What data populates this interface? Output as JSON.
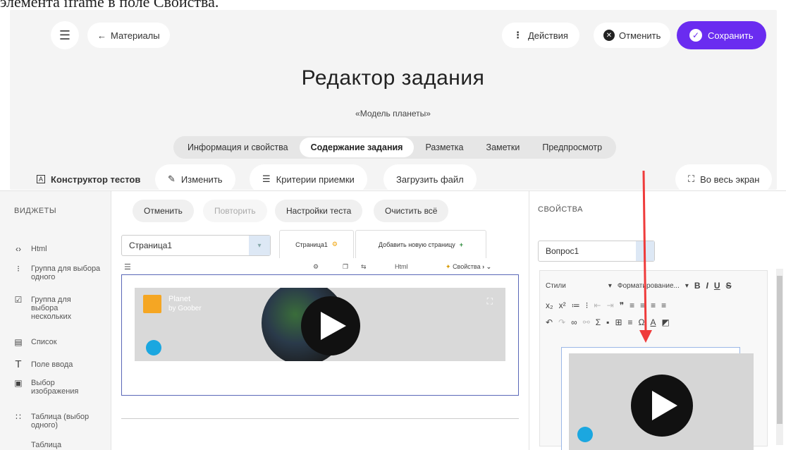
{
  "doc_strip": "элемента iframe в поле Свойства.",
  "header": {
    "back_label": "Материалы",
    "actions_label": "Действия",
    "cancel_label": "Отменить",
    "save_label": "Сохранить",
    "title": "Редактор задания",
    "subtitle": "«Модель планеты»",
    "tabs": [
      "Информация и свойства",
      "Содержание задания",
      "Разметка",
      "Заметки",
      "Предпросмотр"
    ],
    "active_tab": 1,
    "toolbar": {
      "constructor": "Конструктор тестов",
      "edit": "Изменить",
      "criteria": "Критерии приемки",
      "upload": "Загрузить файл",
      "fullscreen": "Во весь экран"
    }
  },
  "widgets": {
    "title": "ВИДЖЕТЫ",
    "items": [
      {
        "icon": "code-icon",
        "label": "Html"
      },
      {
        "icon": "single-choice-icon",
        "label": "Группа для выбора одного"
      },
      {
        "icon": "checkbox-icon",
        "label": "Группа для выбора нескольких"
      },
      {
        "icon": "list-icon",
        "label": "Список"
      },
      {
        "icon": "text-field-icon",
        "label": "Поле ввода"
      },
      {
        "icon": "image-choice-icon",
        "label": "Выбор изображения"
      },
      {
        "icon": "table-single-icon",
        "label": "Таблица (выбор одного)"
      },
      {
        "icon": "table-icon",
        "label": "Таблица"
      }
    ]
  },
  "center": {
    "undo": "Отменить",
    "redo": "Повторить",
    "test_settings": "Настройки теста",
    "clear_all": "Очистить всё",
    "page_select": "Страница1",
    "page_tab": "Страница1",
    "add_page": "Добавить новую страницу",
    "html_label": "Html",
    "properties_label": "Свойства",
    "video_title": "Planet",
    "video_author": "by Goober"
  },
  "properties": {
    "title": "СВОЙСТВА",
    "question_select": "Вопрос1",
    "styles_label": "Стили",
    "format_label": "Форматирование..."
  }
}
